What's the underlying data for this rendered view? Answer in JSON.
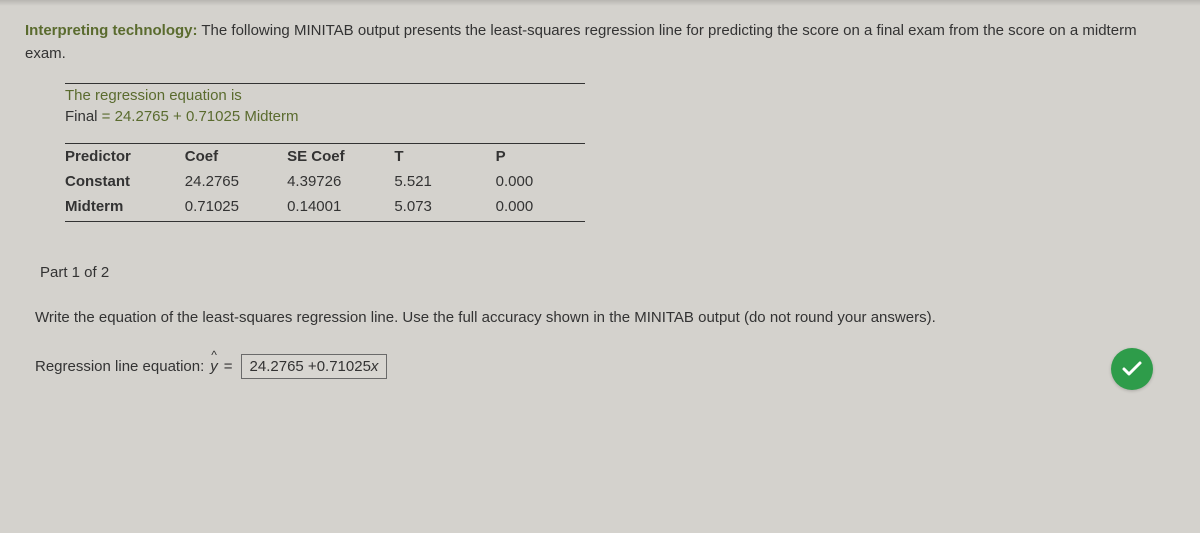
{
  "intro": {
    "title": "Interpreting technology:",
    "text": " The following MINITAB output presents the least-squares regression line for predicting the score on a final exam from the score on a midterm exam."
  },
  "regression": {
    "header": "The regression equation is",
    "lhs": "Final",
    "eq": " = ",
    "rhs": "24.2765 + 0.71025 Midterm"
  },
  "table": {
    "headers": [
      "Predictor",
      "Coef",
      "SE Coef",
      "T",
      "P"
    ],
    "rows": [
      {
        "name": "Constant",
        "coef": "24.2765",
        "se": "4.39726",
        "t": "5.521",
        "p": "0.000"
      },
      {
        "name": "Midterm",
        "coef": "0.71025",
        "se": "0.14001",
        "t": "5.073",
        "p": "0.000"
      }
    ]
  },
  "part": {
    "label": "Part 1 of 2"
  },
  "question": {
    "text": "Write the equation of the least-squares regression line. Use the full accuracy shown in the MINITAB output (do not round your answers)."
  },
  "answer": {
    "label": "Regression line equation: ",
    "yvar": "y",
    "eq": "=",
    "value": "24.2765 +0.71025",
    "xvar": "x"
  }
}
